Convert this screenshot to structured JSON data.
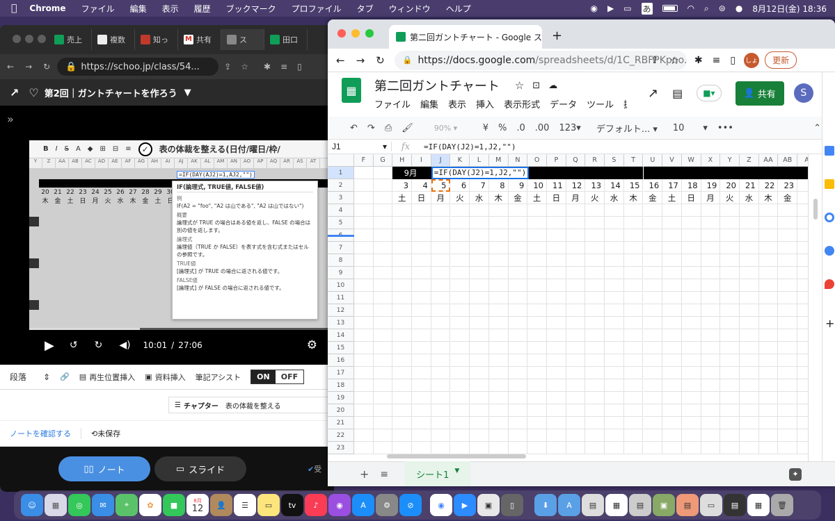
{
  "menubar": {
    "app": "Chrome",
    "items": [
      "ファイル",
      "編集",
      "表示",
      "履歴",
      "ブックマーク",
      "プロファイル",
      "タブ",
      "ウィンドウ",
      "ヘルプ"
    ],
    "ime": "あ",
    "datetime": "8月12日(金)  18:36"
  },
  "left_window": {
    "tabs": [
      {
        "label": "売上",
        "color": "#0f9d58"
      },
      {
        "label": "複数",
        "color": "#eeeeee"
      },
      {
        "label": "知っ",
        "color": "#c0392b"
      },
      {
        "label": "共有",
        "color": "#d93025"
      },
      {
        "label": "ス",
        "color": "#888888"
      },
      {
        "label": "田口",
        "color": "#0f9d58"
      }
    ],
    "url": "https://schoo.jp/class/54...",
    "header_title": "第2回｜ガントチャートを作ろう",
    "video": {
      "slide_title": "表の体裁を整える(日付/曜日/枠/",
      "formula_preview": "=IF(DAY(AJ2)=1,AJ2,\"\")",
      "tooltip_header": "IF(論理式, TRUE値, FALSE値)",
      "tooltip_lines": [
        "例",
        "IF(A2 = \"foo\", \"A2 は山である\", \"A2 は山ではない\")",
        "概要",
        "論理式が TRUE の場合はある値を返し、FALSE の場合は別の値を返します。",
        "論理式",
        "論理値（TRUE か FALSE）を表す式を含む式またはセルの参照です。",
        "TRUE値",
        "[論理式] が TRUE の場合に返される値です。",
        "FALSE値",
        "[論理式] が FALSE の場合に返される値です。"
      ],
      "col_letters": [
        "Y",
        "Z",
        "AA",
        "AB",
        "AC",
        "AD",
        "AE",
        "AF",
        "AG",
        "AH",
        "AI",
        "AJ",
        "AK",
        "AL",
        "AM",
        "AN",
        "AO",
        "AP",
        "AQ",
        "AR",
        "AS",
        "AT"
      ],
      "dates": [
        "20",
        "21",
        "22",
        "23",
        "24",
        "25",
        "26",
        "27",
        "28",
        "29",
        "30"
      ],
      "days": [
        "木",
        "金",
        "土",
        "日",
        "月",
        "火",
        "水",
        "木",
        "金",
        "土",
        "日"
      ],
      "time_current": "10:01",
      "time_sep": "/",
      "time_total": "27:06",
      "progress": 0.37
    },
    "notes": {
      "paragraph": "段落",
      "insert_position": "再生位置挿入",
      "insert_material": "資料挿入",
      "assist_label": "筆記アシスト",
      "on": "ON",
      "off": "OFF",
      "chapter_label": "チャプター",
      "chapter_value": "表の体裁を整える",
      "check_note": "ノートを確認する",
      "unsaved": "未保存",
      "note_btn": "ノート",
      "slide_btn": "スライド",
      "accept": "受"
    }
  },
  "sheets": {
    "tab_title": "第二回ガントチャート - Google ス",
    "url_main": "https://docs.google.com",
    "url_rest": "/spreadsheets/d/1C_RBFPKpno...",
    "profile": "しょ",
    "update_btn": "更新",
    "doc_title": "第二回ガントチャート",
    "menus": [
      "ファイル",
      "編集",
      "表示",
      "挿入",
      "表示形式",
      "データ",
      "ツール",
      "拡"
    ],
    "share_btn": "共有",
    "avatar": "S",
    "zoom": "90%",
    "currency": "¥",
    "percent": "%",
    "dec_less": ".0",
    "dec_more": ".00",
    "numfmt": "123",
    "font": "デフォルト...",
    "fontsize": "10",
    "more": "•••",
    "cell_ref": "J1",
    "fx": "fx",
    "formula": "=IF(DAY(J2)=1,J2,\"\")",
    "columns": [
      "F",
      "G",
      "H",
      "I",
      "J",
      "K",
      "L",
      "M",
      "N",
      "O",
      "P",
      "Q",
      "R",
      "S",
      "T",
      "U",
      "V",
      "W",
      "X",
      "Y",
      "Z",
      "AA",
      "AB",
      "A"
    ],
    "row_numbers": [
      "1",
      "2",
      "3",
      "4",
      "5",
      "6",
      "7",
      "8",
      "9",
      "10",
      "11",
      "12",
      "13",
      "14",
      "15",
      "16",
      "17",
      "18",
      "19",
      "20",
      "21",
      "22",
      "23"
    ],
    "month_label": "9月",
    "dates": [
      "3",
      "4",
      "5",
      "6",
      "7",
      "8",
      "9",
      "10",
      "11",
      "12",
      "13",
      "14",
      "15",
      "16",
      "17",
      "18",
      "19",
      "20",
      "21",
      "22",
      "23"
    ],
    "days": [
      "土",
      "日",
      "月",
      "火",
      "水",
      "木",
      "金",
      "土",
      "日",
      "月",
      "火",
      "水",
      "木",
      "金",
      "土",
      "日",
      "月",
      "火",
      "水",
      "木",
      "金"
    ],
    "sheet_tab": "シート1",
    "add": "+",
    "list": "≡"
  },
  "dock": {
    "calendar_month": "8月",
    "calendar_day": "12",
    "tv": "tv"
  }
}
